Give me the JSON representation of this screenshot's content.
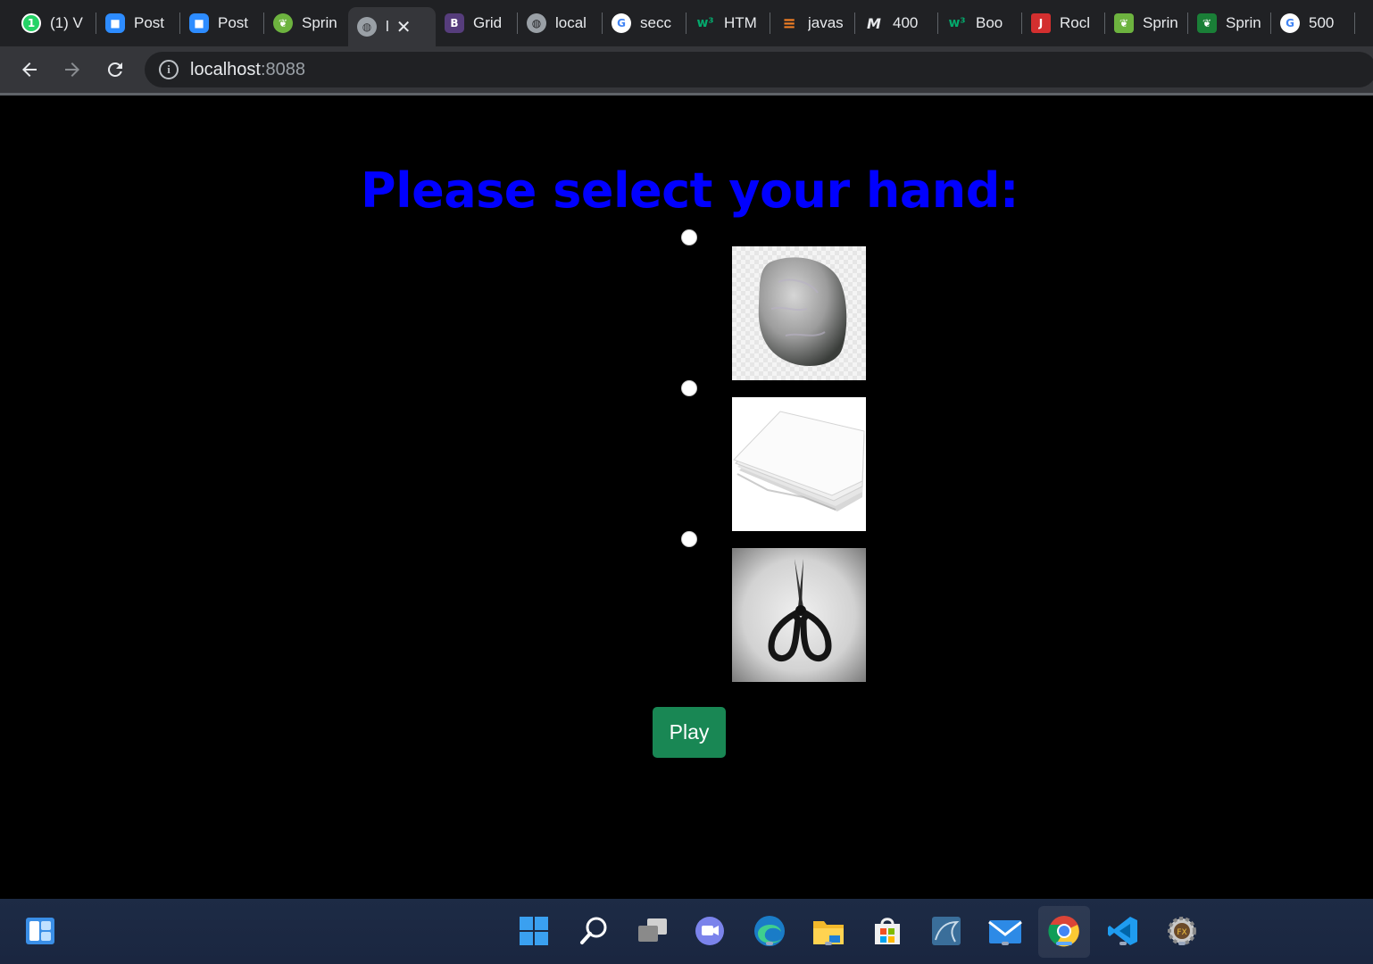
{
  "browser": {
    "tabs": [
      {
        "title": "(1) V",
        "icon": "whatsapp-icon",
        "color": "#25d366",
        "glyph": "1"
      },
      {
        "title": "Post",
        "icon": "zoom-icon",
        "color": "#2d8cff",
        "glyph": "■"
      },
      {
        "title": "Post",
        "icon": "zoom-icon",
        "color": "#2d8cff",
        "glyph": "■"
      },
      {
        "title": "Sprin",
        "icon": "spring-icon",
        "color": "#6db33f",
        "glyph": "❦"
      },
      {
        "title": "l",
        "icon": "globe-icon",
        "color": "#9aa0a6",
        "glyph": "◍",
        "active": true
      },
      {
        "title": "Grid",
        "icon": "bootstrap-icon",
        "color": "#563d7c",
        "glyph": "B"
      },
      {
        "title": "local",
        "icon": "globe-icon",
        "color": "#9aa0a6",
        "glyph": "◍"
      },
      {
        "title": "secc",
        "icon": "google-icon",
        "color": "#ffffff",
        "glyph": "G"
      },
      {
        "title": "HTM",
        "icon": "w3schools-icon",
        "color": "#04aa6d",
        "glyph": "w³"
      },
      {
        "title": "javas",
        "icon": "stackoverflow-icon",
        "color": "#f48024",
        "glyph": "≡"
      },
      {
        "title": "400",
        "icon": "mdn-icon",
        "color": "#e8eaed",
        "glyph": "M"
      },
      {
        "title": "Boo",
        "icon": "w3schools-icon",
        "color": "#04aa6d",
        "glyph": "w³"
      },
      {
        "title": "Rocl",
        "icon": "javatpoint-icon",
        "color": "#d32f2f",
        "glyph": "J"
      },
      {
        "title": "Sprin",
        "icon": "spring-icon",
        "color": "#6db33f",
        "glyph": "❦"
      },
      {
        "title": "Sprin",
        "icon": "spring-icon",
        "color": "#6db33f",
        "glyph": "❦"
      },
      {
        "title": "500",
        "icon": "google-icon",
        "color": "#ffffff",
        "glyph": "G"
      }
    ],
    "close_glyph": "✕",
    "url_host": "localhost",
    "url_port": ":8088"
  },
  "page": {
    "heading": "Please select your hand:",
    "choices": [
      {
        "id": "rock",
        "icon": "rock-image"
      },
      {
        "id": "paper",
        "icon": "paper-image"
      },
      {
        "id": "scissors",
        "icon": "scissors-image"
      }
    ],
    "play_label": "Play"
  },
  "taskbar": {
    "apps": [
      "widgets-icon",
      "start-icon",
      "search-icon",
      "task-view-icon",
      "teams-chat-icon",
      "edge-icon",
      "file-explorer-icon",
      "microsoft-store-icon",
      "mysql-workbench-icon",
      "mail-icon",
      "chrome-icon",
      "vscode-icon",
      "java-ide-icon"
    ]
  },
  "colors": {
    "heading": "#0000ff",
    "play_button": "#198754",
    "page_background": "#000000"
  }
}
